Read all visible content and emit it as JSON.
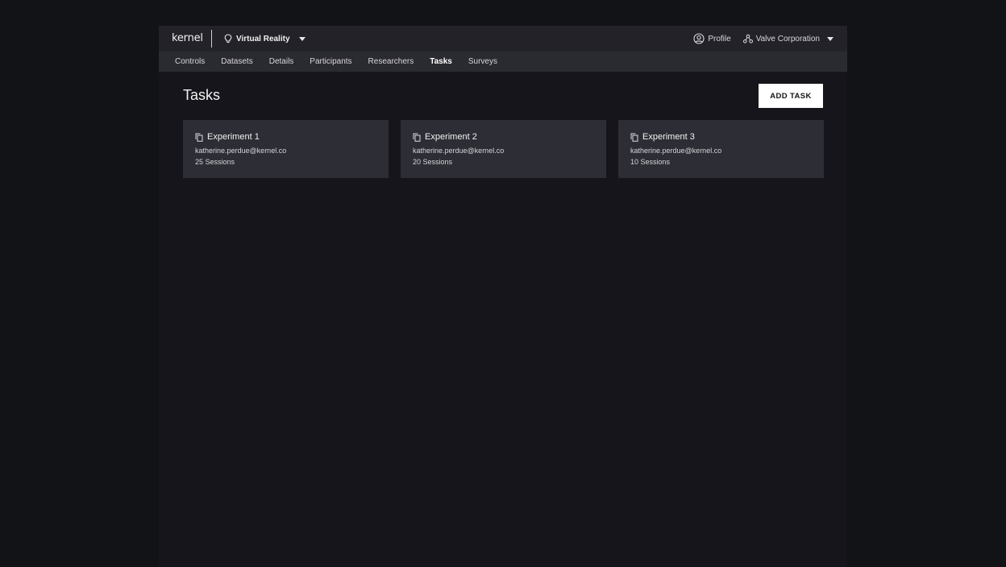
{
  "header": {
    "logo": "kernel",
    "project": "Virtual Reality",
    "profile_label": "Profile",
    "org_label": "Valve Corporation"
  },
  "nav": {
    "items": [
      "Controls",
      "Datasets",
      "Details",
      "Participants",
      "Researchers",
      "Tasks",
      "Surveys"
    ],
    "active": "Tasks"
  },
  "page": {
    "title": "Tasks",
    "add_button": "ADD TASK"
  },
  "tasks": [
    {
      "title": "Experiment 1",
      "owner": "katherine.perdue@kernel.co",
      "sessions": "25 Sessions"
    },
    {
      "title": "Experiment 2",
      "owner": "katherine.perdue@kernel.co",
      "sessions": "20 Sessions"
    },
    {
      "title": "Experiment 3",
      "owner": "katherine.perdue@kernel.co",
      "sessions": "10 Sessions"
    }
  ],
  "icons": {
    "project": "lightbulb-icon",
    "dropdown": "caret-down-icon",
    "profile": "user-circle-icon",
    "org": "organization-icon",
    "task": "copy-icon"
  },
  "colors": {
    "background": "#111317",
    "app": "#15151b",
    "topbar": "#222228",
    "subnav": "#2a2a31",
    "card": "#2d2d35",
    "button": "#ffffff"
  }
}
